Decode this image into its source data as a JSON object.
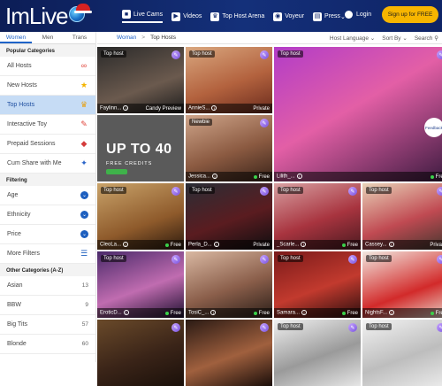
{
  "header": {
    "logo_text": "ImLive",
    "nav": [
      {
        "label": "Live Cams",
        "icon": "camera-icon",
        "glyph": "■"
      },
      {
        "label": "Videos",
        "icon": "play-icon",
        "glyph": "▶"
      },
      {
        "label": "Top Host Arena",
        "icon": "trophy-icon",
        "glyph": "♛"
      },
      {
        "label": "Voyeur",
        "icon": "voyeur-icon",
        "glyph": "◉"
      },
      {
        "label": "Press",
        "icon": "press-icon",
        "glyph": "▤"
      }
    ],
    "login": "Login",
    "signup": "Sign up for FREE"
  },
  "sidebar": {
    "tabs": [
      "Women",
      "Men",
      "Trans"
    ],
    "popular_title": "Popular Categories",
    "popular": [
      {
        "label": "All Hosts",
        "icon": "infinity-icon",
        "glyph": "∞",
        "color": "#e0443a"
      },
      {
        "label": "New Hosts",
        "icon": "star-icon",
        "glyph": "★",
        "color": "#f4b400"
      },
      {
        "label": "Top Hosts",
        "icon": "crown-icon",
        "glyph": "♛",
        "color": "#e6a21a"
      },
      {
        "label": "Interactive Toy",
        "icon": "toy-icon",
        "glyph": "✎",
        "color": "#e0443a"
      },
      {
        "label": "Prepaid Sessions",
        "icon": "tag-icon",
        "glyph": "◆",
        "color": "#d43c3c"
      },
      {
        "label": "Cum Share with Me",
        "icon": "wand-icon",
        "glyph": "✦",
        "color": "#2a64c8"
      }
    ],
    "filtering_title": "Filtering",
    "filters": [
      {
        "label": "Age"
      },
      {
        "label": "Ethnicity"
      },
      {
        "label": "Price"
      },
      {
        "label": "More Filters"
      }
    ],
    "other_title": "Other Categories (A-Z)",
    "other": [
      {
        "label": "Asian",
        "count": "13"
      },
      {
        "label": "BBW",
        "count": "9"
      },
      {
        "label": "Big Tits",
        "count": "57"
      },
      {
        "label": "Blonde",
        "count": "60"
      }
    ]
  },
  "filterbar": {
    "crumb_root": "Woman",
    "crumb_sep": ">",
    "crumb_current": "Top Hosts",
    "host_language": "Host Language",
    "sort_by": "Sort By",
    "search": "Search"
  },
  "tiles": [
    {
      "tag": "Top host",
      "name": "Faylinn...",
      "status": "Candy Preview",
      "bg": "linear-gradient(160deg,#2a2a2a,#6b5a4e 60%,#1c1c1c)"
    },
    {
      "tag": "Top host",
      "name": "AnnieS...",
      "status": "Private",
      "bg": "linear-gradient(160deg,#d9a77f,#b3623e 55%,#6a2b1d)"
    },
    {
      "tag": "Top host",
      "name": "Lilith_...",
      "status": "Free",
      "bg": "linear-gradient(150deg,#b23cc8,#e35fa6 45%,#3a1a3e 100%)"
    },
    {
      "tag": "Newbie",
      "name": "Jessica...",
      "status": "Free",
      "bg": "linear-gradient(160deg,#cfa58a,#8b5a41 55%,#3a241a)"
    },
    {
      "tag": "Top host",
      "name": "CleoLa...",
      "status": "Free",
      "bg": "linear-gradient(160deg,#c9a36a,#8e5a2b 60%,#2c1a0e)"
    },
    {
      "tag": "Top host",
      "name": "Perla_D...",
      "status": "Private",
      "bg": "linear-gradient(160deg,#2a2e36,#5a1c20 55%,#0e0e10)"
    },
    {
      "tag": "Top host",
      "name": "_Scarle...",
      "status": "Free",
      "bg": "linear-gradient(160deg,#d8a0a2,#a8343f 55%,#4a1a20)"
    },
    {
      "tag": "Top host",
      "name": "Cassey...",
      "status": "Private",
      "bg": "linear-gradient(160deg,#e9d2b8,#c04a52 55%,#40362e)"
    },
    {
      "tag": "Top host",
      "name": "EroticD...",
      "status": "Free",
      "bg": "linear-gradient(160deg,#4a2a6a,#c06cb0 55%,#1e1030)"
    },
    {
      "tag": "",
      "name": "TosiC_...",
      "status": "Free",
      "bg": "linear-gradient(160deg,#d9b8a2,#8a5e4a 55%,#2a1e18)"
    },
    {
      "tag": "Top host",
      "name": "Samara...",
      "status": "Free",
      "bg": "linear-gradient(160deg,#7a1a1a,#c23a2e 55%,#2a0e0e)"
    },
    {
      "tag": "Top host",
      "name": "NightsF...",
      "status": "Free",
      "bg": "linear-gradient(160deg,#f2e8e0,#d22a2a 60%,#e8d8cc)"
    },
    {
      "tag": "",
      "name": "",
      "status": "",
      "bg": "linear-gradient(160deg,#6a4a2a,#3a2418 55%,#1a100a)"
    },
    {
      "tag": "",
      "name": "",
      "status": "",
      "bg": "linear-gradient(160deg,#2a1a14,#a0603e 55%,#1a0e0a)"
    },
    {
      "tag": "Top host",
      "name": "",
      "status": "",
      "bg": "linear-gradient(160deg,#f0f0f0,#9a9a9a 55%,#e6e6e6)"
    },
    {
      "tag": "Top host",
      "name": "",
      "status": "",
      "bg": "linear-gradient(160deg,#f3f3f3,#bdbdbd 55%,#ececec)"
    }
  ],
  "promo": {
    "line1": "UP TO 40",
    "line2": "FREE CREDITS"
  },
  "feedback": "Feedback"
}
